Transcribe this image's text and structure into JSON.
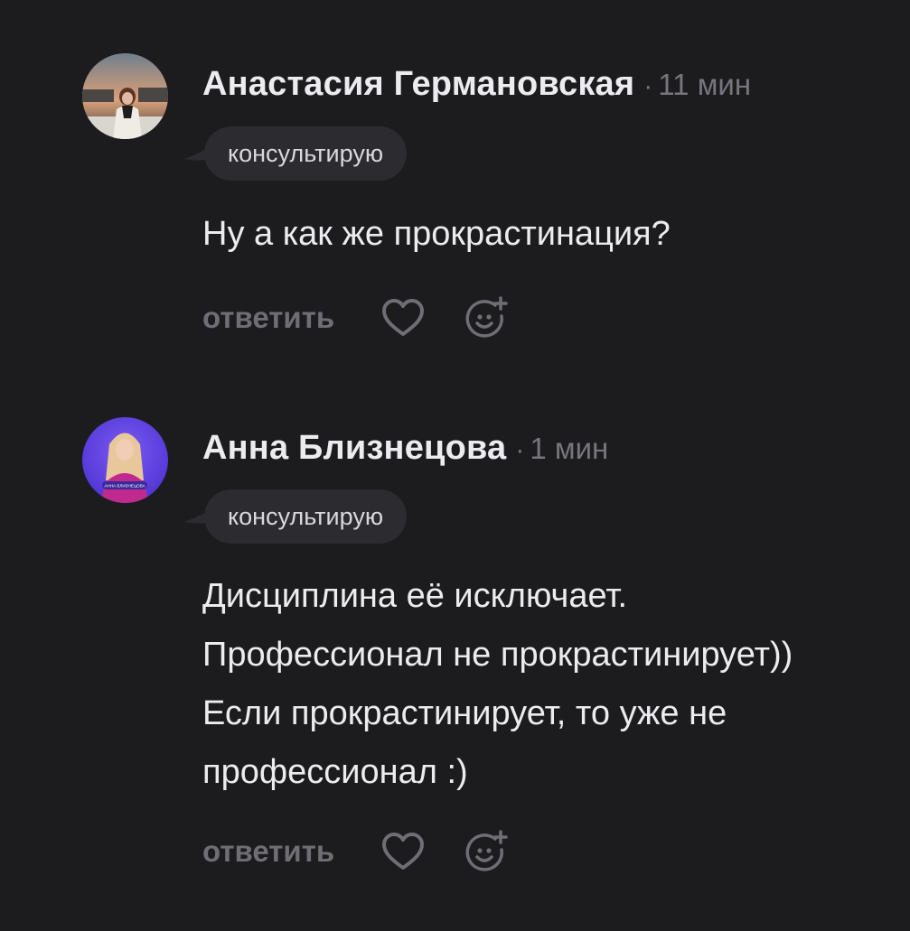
{
  "comments": [
    {
      "author": "Анастасия Германовская",
      "separator": "·",
      "time": "11 мин",
      "badge": "консультирую",
      "text_lines": [
        "Ну а как же прокрастинация?"
      ],
      "actions": {
        "reply": "ответить",
        "like_icon": "heart-outline",
        "reaction_icon": "smile-plus"
      },
      "avatar_icon": "photo-woman-city"
    },
    {
      "author": "Анна Близнецова",
      "separator": "·",
      "time": "1 мин",
      "badge": "консультирую",
      "text_lines": [
        "Дисциплина её исключает.",
        "Профессионал не прокрастинирует))",
        "Если прокрастинирует, то уже не",
        "профессионал :)"
      ],
      "actions": {
        "reply": "ответить",
        "like_icon": "heart-outline",
        "reaction_icon": "smile-plus"
      },
      "avatar_icon": "photo-woman-purple",
      "avatar_caption": "АННА БЛИЗНЕЦОВА"
    }
  ],
  "colors": {
    "background": "#1c1b1e",
    "text_primary": "#ecebef",
    "text_muted": "#77767c",
    "badge_bg": "#2c2b30",
    "icon": "#6f6e74"
  }
}
